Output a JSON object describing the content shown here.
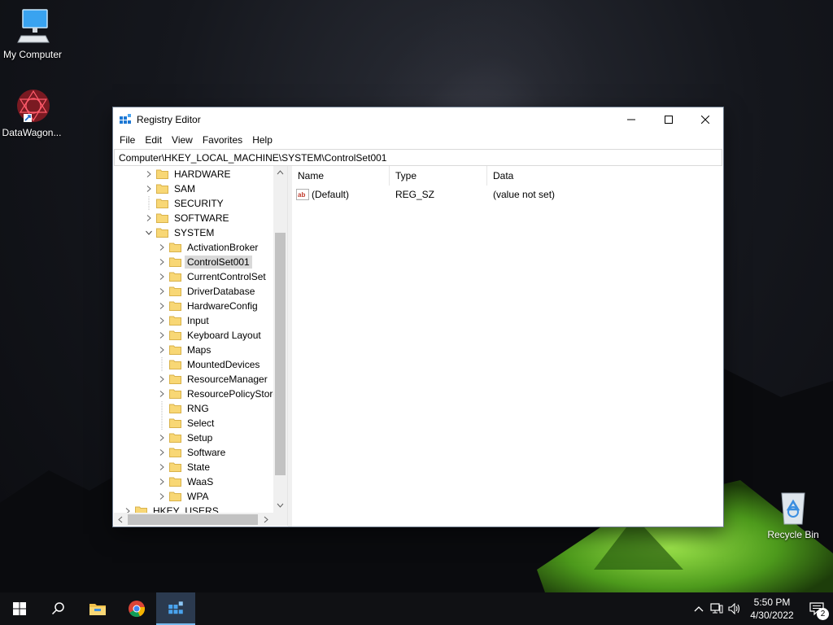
{
  "desktop": {
    "icons": [
      {
        "label": "My Computer"
      },
      {
        "label": "DataWagon..."
      },
      {
        "label": "Recycle Bin"
      }
    ]
  },
  "window": {
    "title": "Registry Editor",
    "menu": [
      "File",
      "Edit",
      "View",
      "Favorites",
      "Help"
    ],
    "address": "Computer\\HKEY_LOCAL_MACHINE\\SYSTEM\\ControlSet001",
    "tree": [
      {
        "label": "HARDWARE",
        "level": 1,
        "expander": "collapsed"
      },
      {
        "label": "SAM",
        "level": 1,
        "expander": "collapsed"
      },
      {
        "label": "SECURITY",
        "level": 1,
        "expander": "none"
      },
      {
        "label": "SOFTWARE",
        "level": 1,
        "expander": "collapsed"
      },
      {
        "label": "SYSTEM",
        "level": 1,
        "expander": "expanded"
      },
      {
        "label": "ActivationBroker",
        "level": 2,
        "expander": "collapsed"
      },
      {
        "label": "ControlSet001",
        "level": 2,
        "expander": "collapsed",
        "selected": true
      },
      {
        "label": "CurrentControlSet",
        "level": 2,
        "expander": "collapsed"
      },
      {
        "label": "DriverDatabase",
        "level": 2,
        "expander": "collapsed"
      },
      {
        "label": "HardwareConfig",
        "level": 2,
        "expander": "collapsed"
      },
      {
        "label": "Input",
        "level": 2,
        "expander": "collapsed"
      },
      {
        "label": "Keyboard Layout",
        "level": 2,
        "expander": "collapsed"
      },
      {
        "label": "Maps",
        "level": 2,
        "expander": "collapsed"
      },
      {
        "label": "MountedDevices",
        "level": 2,
        "expander": "none"
      },
      {
        "label": "ResourceManager",
        "level": 2,
        "expander": "collapsed"
      },
      {
        "label": "ResourcePolicyStore",
        "level": 2,
        "expander": "collapsed"
      },
      {
        "label": "RNG",
        "level": 2,
        "expander": "none"
      },
      {
        "label": "Select",
        "level": 2,
        "expander": "none"
      },
      {
        "label": "Setup",
        "level": 2,
        "expander": "collapsed"
      },
      {
        "label": "Software",
        "level": 2,
        "expander": "collapsed"
      },
      {
        "label": "State",
        "level": 2,
        "expander": "collapsed"
      },
      {
        "label": "WaaS",
        "level": 2,
        "expander": "collapsed"
      },
      {
        "label": "WPA",
        "level": 2,
        "expander": "collapsed"
      },
      {
        "label": "HKEY_USERS",
        "level": 0,
        "expander": "collapsed"
      }
    ],
    "columns": {
      "name": "Name",
      "type": "Type",
      "data": "Data"
    },
    "values": [
      {
        "name": "(Default)",
        "type": "REG_SZ",
        "data": "(value not set)",
        "icon": "string-value-icon"
      }
    ]
  },
  "taskbar": {
    "apps": [
      "start-icon",
      "search-icon",
      "file-explorer-icon",
      "chrome-icon",
      "regedit-icon"
    ],
    "active_app": "regedit-icon",
    "clock": {
      "time": "5:50 PM",
      "date": "4/30/2022"
    },
    "notifications_count": "2"
  },
  "colors": {
    "taskbar": "#101114",
    "folder": "#f8d775",
    "selection": "#d9d9d9",
    "accent": "#76b9ed"
  }
}
